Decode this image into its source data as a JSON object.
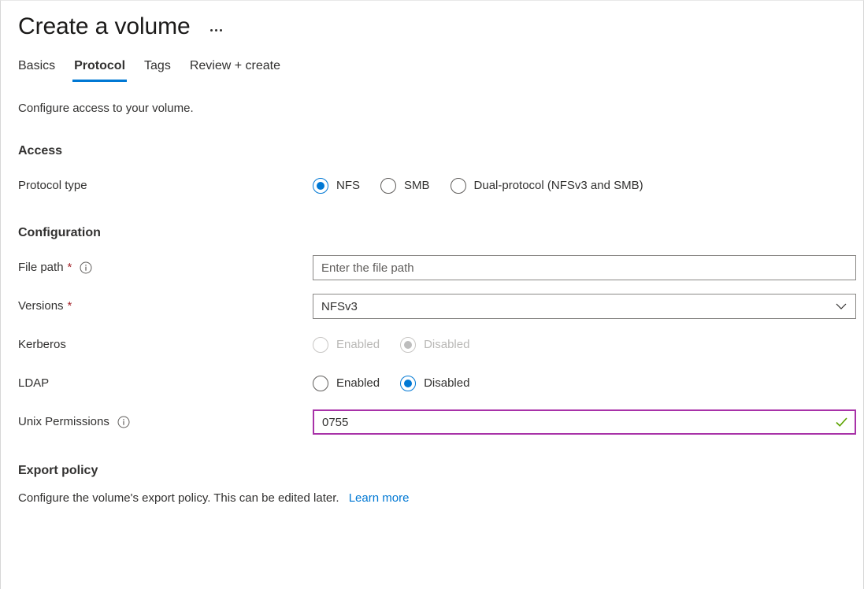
{
  "header": {
    "title": "Create a volume",
    "more_menu": "…"
  },
  "tabs": [
    {
      "label": "Basics",
      "active": false
    },
    {
      "label": "Protocol",
      "active": true
    },
    {
      "label": "Tags",
      "active": false
    },
    {
      "label": "Review + create",
      "active": false
    }
  ],
  "intro": "Configure access to your volume.",
  "access": {
    "section_title": "Access",
    "protocol_type": {
      "label": "Protocol type",
      "selected": "NFS",
      "options": [
        {
          "label": "NFS",
          "checked": true
        },
        {
          "label": "SMB",
          "checked": false
        },
        {
          "label": "Dual-protocol (NFSv3 and SMB)",
          "checked": false
        }
      ]
    }
  },
  "configuration": {
    "section_title": "Configuration",
    "file_path": {
      "label": "File path",
      "required": "*",
      "value": "",
      "placeholder": "Enter the file path"
    },
    "versions": {
      "label": "Versions",
      "required": "*",
      "value": "NFSv3"
    },
    "kerberos": {
      "label": "Kerberos",
      "selected": "Disabled",
      "disabled": true,
      "options": [
        {
          "label": "Enabled",
          "checked": false
        },
        {
          "label": "Disabled",
          "checked": true
        }
      ]
    },
    "ldap": {
      "label": "LDAP",
      "selected": "Disabled",
      "disabled": false,
      "options": [
        {
          "label": "Enabled",
          "checked": false
        },
        {
          "label": "Disabled",
          "checked": true
        }
      ]
    },
    "unix_permissions": {
      "label": "Unix Permissions",
      "value": "0755",
      "valid": true
    }
  },
  "export_policy": {
    "section_title": "Export policy",
    "description": "Configure the volume's export policy. This can be edited later.",
    "link_label": "Learn more"
  },
  "colors": {
    "accent_blue": "#0078d4",
    "required_red": "#a4262c",
    "validated_border": "#a832a8",
    "valid_check_green": "#5ca300",
    "text": "#323130",
    "disabled_text": "#b9b8b6"
  }
}
